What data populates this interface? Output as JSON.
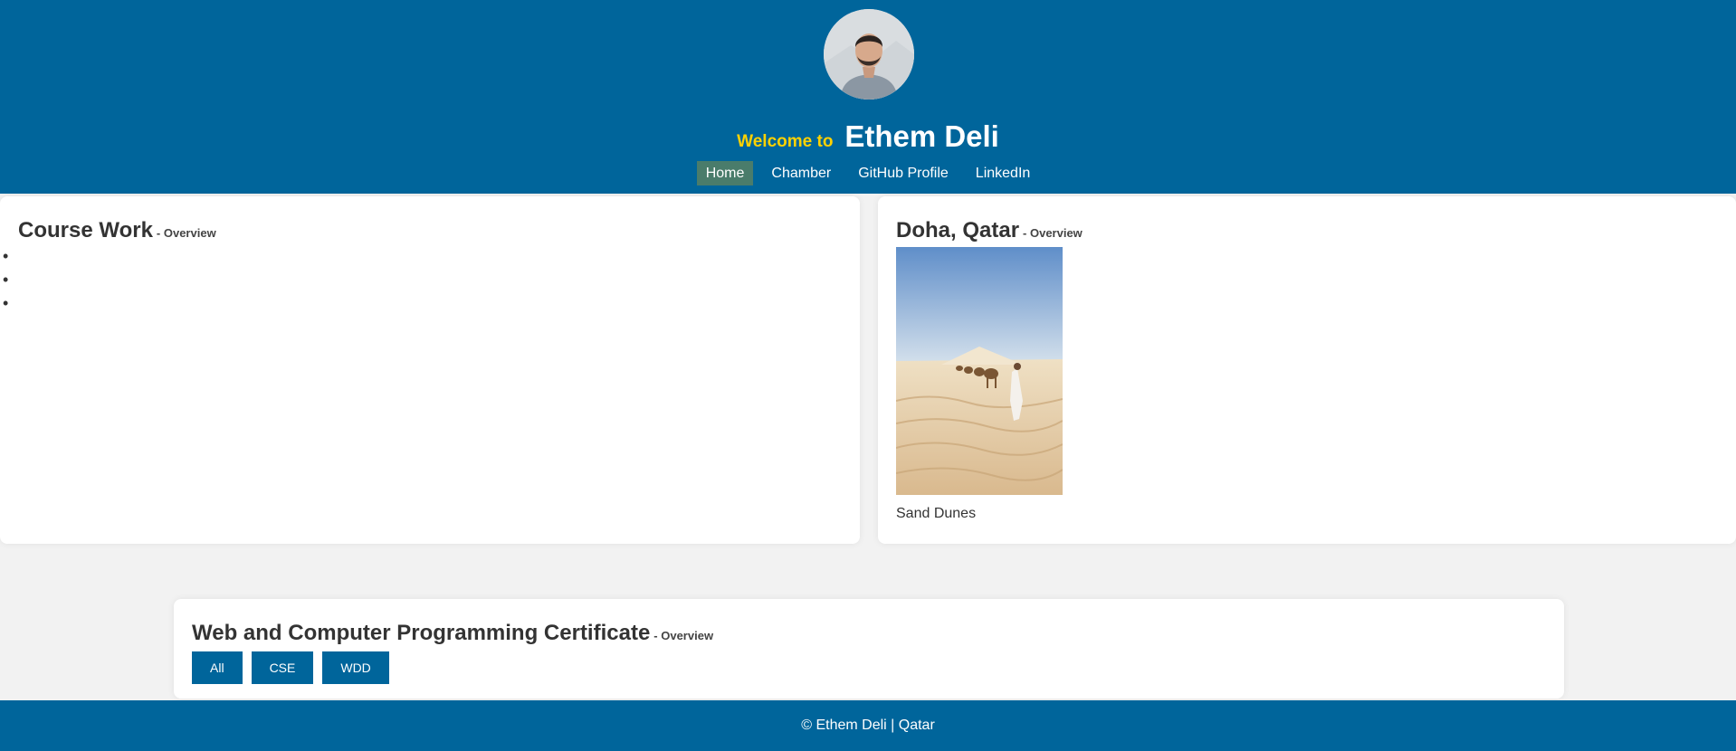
{
  "header": {
    "welcome_prefix": "Welcome to",
    "name": "Ethem Deli",
    "avatar_icon": "profile-photo",
    "colors": {
      "background": "#00659b",
      "welcome": "#ffd200",
      "active_nav": "#4a7c6b"
    }
  },
  "nav": {
    "items": [
      {
        "label": "Home",
        "active": true
      },
      {
        "label": "Chamber",
        "active": false
      },
      {
        "label": "GitHub Profile",
        "active": false
      },
      {
        "label": "LinkedIn",
        "active": false
      }
    ]
  },
  "course": {
    "title": "Course Work",
    "subtitle": "- Overview",
    "items": [
      "",
      "",
      ""
    ]
  },
  "place": {
    "title": "Doha, Qatar",
    "subtitle": "- Overview",
    "caption": "Sand Dunes",
    "photo_icon": "desert-camel-photo"
  },
  "certificate": {
    "title": "Web and Computer Programming Certificate",
    "subtitle": "- Overview",
    "filters": [
      "All",
      "CSE",
      "WDD"
    ]
  },
  "footer": {
    "text": "© Ethem Deli | Qatar"
  }
}
